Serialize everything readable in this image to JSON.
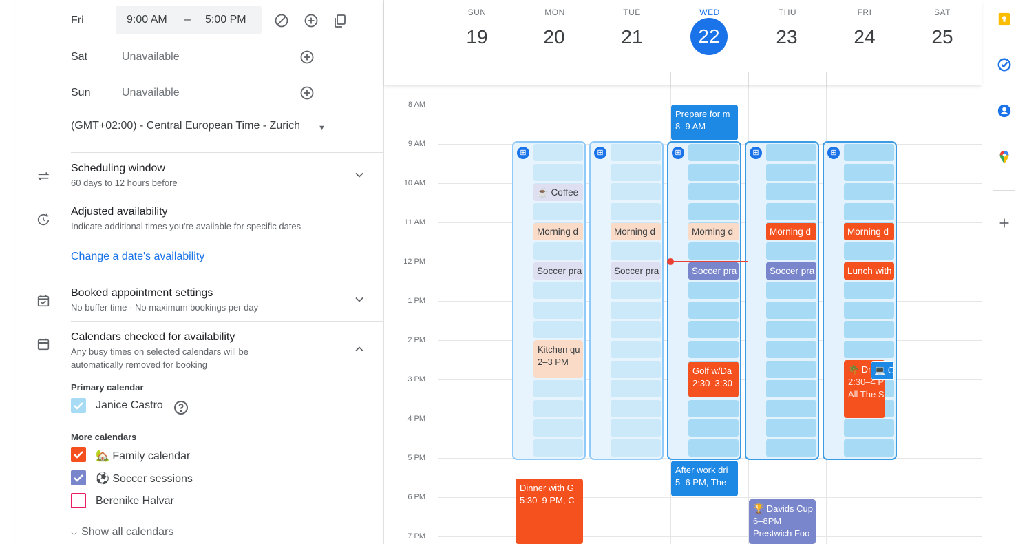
{
  "availability": {
    "fri": {
      "day": "Fri",
      "start": "9:00 AM",
      "dash": "–",
      "end": "5:00 PM"
    },
    "sat": {
      "day": "Sat",
      "status": "Unavailable"
    },
    "sun": {
      "day": "Sun",
      "status": "Unavailable"
    },
    "timezone": "(GMT+02:00) - Central European Time - Zurich"
  },
  "sections": {
    "scheduling_window": {
      "title": "Scheduling window",
      "subtitle": "60 days to 12 hours before"
    },
    "adjusted_availability": {
      "title": "Adjusted availability",
      "subtitle": "Indicate additional times you're available for specific dates",
      "link": "Change a date's availability"
    },
    "booked_settings": {
      "title": "Booked appointment settings",
      "subtitle": "No buffer time · No maximum bookings per day"
    },
    "calendars_checked": {
      "title": "Calendars checked for availability",
      "subtitle_1": "Any busy times on selected calendars will be",
      "subtitle_2": "automatically removed for booking"
    }
  },
  "calendars": {
    "primary_heading": "Primary calendar",
    "primary": {
      "name": "Janice Castro",
      "color": "#a8dcf4"
    },
    "more_heading": "More calendars",
    "more": [
      {
        "name": "🏡 Family calendar",
        "color": "#f4511e",
        "checked": true
      },
      {
        "name": "⚽ Soccer sessions",
        "color": "#7986cb",
        "checked": true
      },
      {
        "name": "Berenike Halvar",
        "color": "#e91e63",
        "checked": false
      }
    ],
    "show_all": "Show all calendars"
  },
  "week": {
    "days": [
      {
        "dow": "SUN",
        "num": "19"
      },
      {
        "dow": "MON",
        "num": "20"
      },
      {
        "dow": "TUE",
        "num": "21"
      },
      {
        "dow": "WED",
        "num": "22",
        "today": true
      },
      {
        "dow": "THU",
        "num": "23"
      },
      {
        "dow": "FRI",
        "num": "24"
      },
      {
        "dow": "SAT",
        "num": "25"
      }
    ],
    "hours": [
      "8 AM",
      "9 AM",
      "10 AM",
      "11 AM",
      "12 PM",
      "1 PM",
      "2 PM",
      "3 PM",
      "4 PM",
      "5 PM",
      "6 PM",
      "7 PM"
    ]
  },
  "events": {
    "prepare": {
      "title": "Prepare for m",
      "time": "8–9 AM"
    },
    "coffee": {
      "title": "☕ Coffee"
    },
    "morning": {
      "title": "Morning d"
    },
    "soccer": {
      "title": "Soccer pra"
    },
    "lunch": {
      "title": "Lunch with"
    },
    "kitchen": {
      "title": "Kitchen qu",
      "time": "2–3 PM"
    },
    "golf": {
      "title": "Golf w/Da",
      "time": "2:30–3:30"
    },
    "dr": {
      "title": "🌴 Dr",
      "time": "2:30–4 P",
      "place": "All The S"
    },
    "chip": {
      "title": "💻 C"
    },
    "after_work": {
      "title": "After work dri",
      "time": "5–6 PM, The"
    },
    "dinner": {
      "title": "Dinner with G",
      "time": "5:30–9 PM, C"
    },
    "davids": {
      "title": "🏆 Davids Cup",
      "time": "6–8PM",
      "place": "Prestwich Foo"
    }
  },
  "colors": {
    "accent": "#1a73e8",
    "family": "#f4511e",
    "soccer": "#7986cb",
    "now": "#ea4335"
  }
}
